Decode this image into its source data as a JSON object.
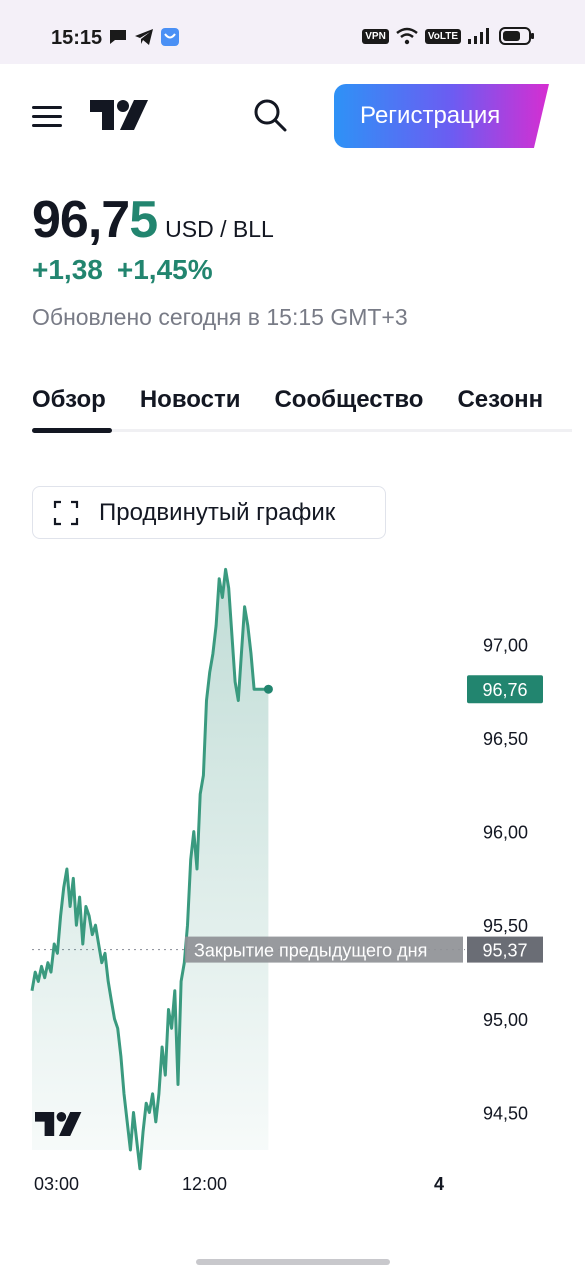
{
  "status_bar": {
    "time": "15:15",
    "icons": [
      "chat-bubble-icon",
      "telegram-icon",
      "app-icon"
    ],
    "vpn": "VPN",
    "volte": "VoLTE",
    "right_icons": [
      "wifi-icon",
      "signal-icon",
      "battery-icon"
    ]
  },
  "header": {
    "register_label": "Регистрация",
    "icons": [
      "menu-icon",
      "tradingview-logo",
      "search-icon"
    ]
  },
  "quote": {
    "price_main": "96,7",
    "price_last": "5",
    "unit": "USD / BLL",
    "change_abs": "+1,38",
    "change_pct": "+1,45%",
    "updated": "Обновлено сегодня в 15:15 GMT+3"
  },
  "tabs": [
    {
      "label": "Обзор",
      "active": true
    },
    {
      "label": "Новости",
      "active": false
    },
    {
      "label": "Сообщество",
      "active": false
    },
    {
      "label": "Сезонн",
      "active": false
    }
  ],
  "advanced_chart": {
    "label": "Продвинутый график",
    "icon": "fullscreen-icon"
  },
  "colors": {
    "accent_green": "#22856f",
    "text": "#131722",
    "muted": "#787b86"
  },
  "chart_data": {
    "type": "area",
    "y_ticks": [
      "97,00",
      "96,50",
      "96,00",
      "95,50",
      "95,00",
      "94,50"
    ],
    "y_tick_values": [
      97.0,
      96.5,
      96.0,
      95.5,
      95.0,
      94.5
    ],
    "x_ticks": [
      "03:00",
      "12:00",
      "4"
    ],
    "last_value_label": "96,76",
    "prev_close_label": "Закрытие предыдущего дня",
    "prev_close_value_label": "95,37",
    "last_value": 96.76,
    "prev_close": 95.37,
    "ylim": [
      94.3,
      97.45
    ],
    "x_range_hours": [
      1,
      16
    ],
    "series": [
      {
        "x": [
          1.0,
          1.2,
          1.4,
          1.6,
          1.8,
          2.0,
          2.2,
          2.4,
          2.6,
          2.8,
          3.0,
          3.2,
          3.4,
          3.6,
          3.8,
          4.0,
          4.2,
          4.4,
          4.6,
          4.8,
          5.0,
          5.2,
          5.4,
          5.6,
          5.8,
          6.0,
          6.2,
          6.4,
          6.6,
          6.8,
          7.0,
          7.2,
          7.4,
          7.6,
          7.8,
          8.0,
          8.2,
          8.4,
          8.6,
          8.8,
          9.0,
          9.2,
          9.4,
          9.6,
          9.8,
          10.0,
          10.2,
          10.4,
          10.6,
          10.8,
          11.0,
          11.2,
          11.4,
          11.6,
          11.8,
          12.0,
          12.2,
          12.4,
          12.6,
          12.8,
          13.0,
          13.2,
          13.4,
          13.6,
          13.8,
          14.0,
          14.2,
          14.4,
          14.6,
          14.8,
          15.0,
          15.2,
          15.4,
          15.6,
          15.8,
          15.9
        ],
        "y": [
          95.15,
          95.25,
          95.2,
          95.28,
          95.22,
          95.3,
          95.25,
          95.4,
          95.35,
          95.55,
          95.7,
          95.8,
          95.6,
          95.75,
          95.5,
          95.65,
          95.4,
          95.6,
          95.55,
          95.45,
          95.5,
          95.4,
          95.3,
          95.35,
          95.2,
          95.1,
          95.0,
          94.95,
          94.8,
          94.6,
          94.45,
          94.3,
          94.5,
          94.35,
          94.2,
          94.4,
          94.55,
          94.5,
          94.6,
          94.45,
          94.6,
          94.85,
          94.7,
          95.05,
          94.95,
          95.15,
          94.65,
          95.2,
          95.3,
          95.5,
          95.85,
          96.0,
          95.8,
          96.2,
          96.3,
          96.7,
          96.85,
          96.95,
          97.1,
          97.35,
          97.25,
          97.4,
          97.3,
          97.05,
          96.8,
          96.7,
          96.95,
          97.2,
          97.1,
          96.95,
          96.76,
          96.76,
          96.76,
          96.76,
          96.76,
          96.76
        ]
      }
    ]
  }
}
